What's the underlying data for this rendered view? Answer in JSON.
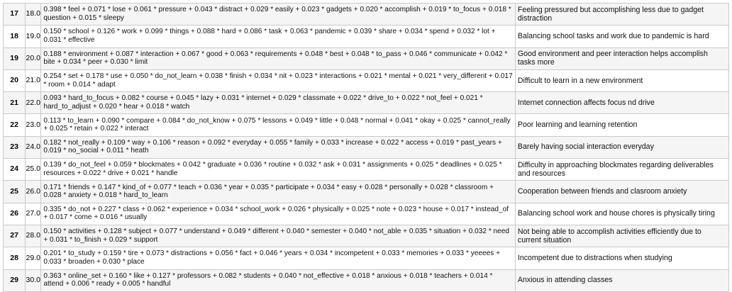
{
  "rows": [
    {
      "index": "17",
      "topic": "18.0",
      "keywords": "0.398 * feel + 0.071 * lose + 0.061 * pressure + 0.043 * distract + 0.029 * easily + 0.023 * gadgets + 0.020 * accomplish + 0.019 * to_focus + 0.018 * question + 0.015 * sleepy",
      "label": "Feeling pressured but accomplishing less due to gadget distraction"
    },
    {
      "index": "18",
      "topic": "19.0",
      "keywords": "0.150 * school + 0.126 * work + 0.099 * things + 0.088 * hard + 0.086 * task + 0.063 * pandemic + 0.039 * share + 0.034 * spend + 0.032 * lot + 0.031 * effective",
      "label": "Balancing school tasks and work due to pandemic is hard"
    },
    {
      "index": "19",
      "topic": "20.0",
      "keywords": "0.188 * environment + 0.087 * interaction + 0.067 * good + 0.063 * requirements + 0.048 * best + 0.048 * to_pass + 0.046 * communicate + 0.042 * bite + 0.034 * peer + 0.030 * limit",
      "label": "Good environment and peer interaction helps accomplish tasks more"
    },
    {
      "index": "20",
      "topic": "21.0",
      "keywords": "0.254 * set + 0.178 * use + 0.050 * do_not_learn + 0.038 * finish + 0.034 * nit + 0.023 * interactions + 0.021 * mental + 0.021 * very_different + 0.017 * room + 0.014 * adapt",
      "label": "Difficult to learn in a new environment"
    },
    {
      "index": "21",
      "topic": "22.0",
      "keywords": "0.093 * hard_to_focus + 0.082 * course + 0.045 * lazy + 0.031 * internet + 0.029 * classmate + 0.022 * drive_to + 0.022 * not_feel + 0.021 * hard_to_adjust + 0.020 * hear + 0.018 * watch",
      "label": "Internet connection affects focus nd drive"
    },
    {
      "index": "22",
      "topic": "23.0",
      "keywords": "0.113 * to_learn + 0.090 * compare + 0.084 * do_not_know + 0.075 * lessons + 0.049 * little + 0.048 * normal + 0.041 * okay + 0.025 * cannot_really + 0.025 * retain + 0.022 * interact",
      "label": "Poor learning and learning retention"
    },
    {
      "index": "23",
      "topic": "24.0",
      "keywords": "0.182 * not_really + 0.109 * way + 0.106 * reason + 0.092 * everyday + 0.055 * family + 0.033 * increase + 0.022 * access + 0.019 * past_years + 0.019 * no_social + 0.011 * heath",
      "label": "Barely having social interaction everyday"
    },
    {
      "index": "24",
      "topic": "25.0",
      "keywords": "0.139 * do_not_feel + 0.059 * blockmates + 0.042 * graduate + 0.036 * routine + 0.032 * ask + 0.031 * assignments + 0.025 * deadlines + 0.025 * resources + 0.022 * drive + 0.021 * handle",
      "label": "Difficulty in approaching blockmates regarding deliverables and resources"
    },
    {
      "index": "25",
      "topic": "26.0",
      "keywords": "0.171 * friends + 0.147 * kind_of + 0.077 * teach + 0.036 * year + 0.035 * participate + 0.034 * easy + 0.028 * personally + 0.028 * classroom + 0.028 * anxiety + 0.018 * hard_to_learn",
      "label": "Cooperation between friends and clasroom anxiety"
    },
    {
      "index": "26",
      "topic": "27.0",
      "keywords": "0.335 * do_not + 0.227 * class + 0.062 * experience + 0.034 * school_work + 0.026 * physically + 0.025 * note + 0.023 * house + 0.017 * instead_of + 0.017 * come + 0.016 * usually",
      "label": "Balancing school work and house chores is physically tiring"
    },
    {
      "index": "27",
      "topic": "28.0",
      "keywords": "0.150 * activities + 0.128 * subject + 0.077 * understand + 0.049 * different + 0.040 * semester + 0.040 * not_able + 0.035 * situation + 0.032 * need + 0.031 * to_finish + 0.029 * support",
      "label": "Not being able to accomplish activities efficiently due to current situation"
    },
    {
      "index": "28",
      "topic": "29.0",
      "keywords": "0.201 * to_study + 0.159 * tire + 0.073 * distractions + 0.056 * fact + 0.046 * years + 0.034 * incompetent + 0.033 * memories + 0.033 * yeeees + 0.033 * broaden + 0.030 * place",
      "label": "Incompetent due to distractions when studying"
    },
    {
      "index": "29",
      "topic": "30.0",
      "keywords": "0.363 * online_set + 0.160 * like + 0.127 * professors + 0.082 * students + 0.040 * not_effective + 0.018 * anxious + 0.018 * teachers + 0.014 * attend + 0.006 * ready + 0.005 * handful",
      "label": "Anxious in attending classes"
    }
  ]
}
